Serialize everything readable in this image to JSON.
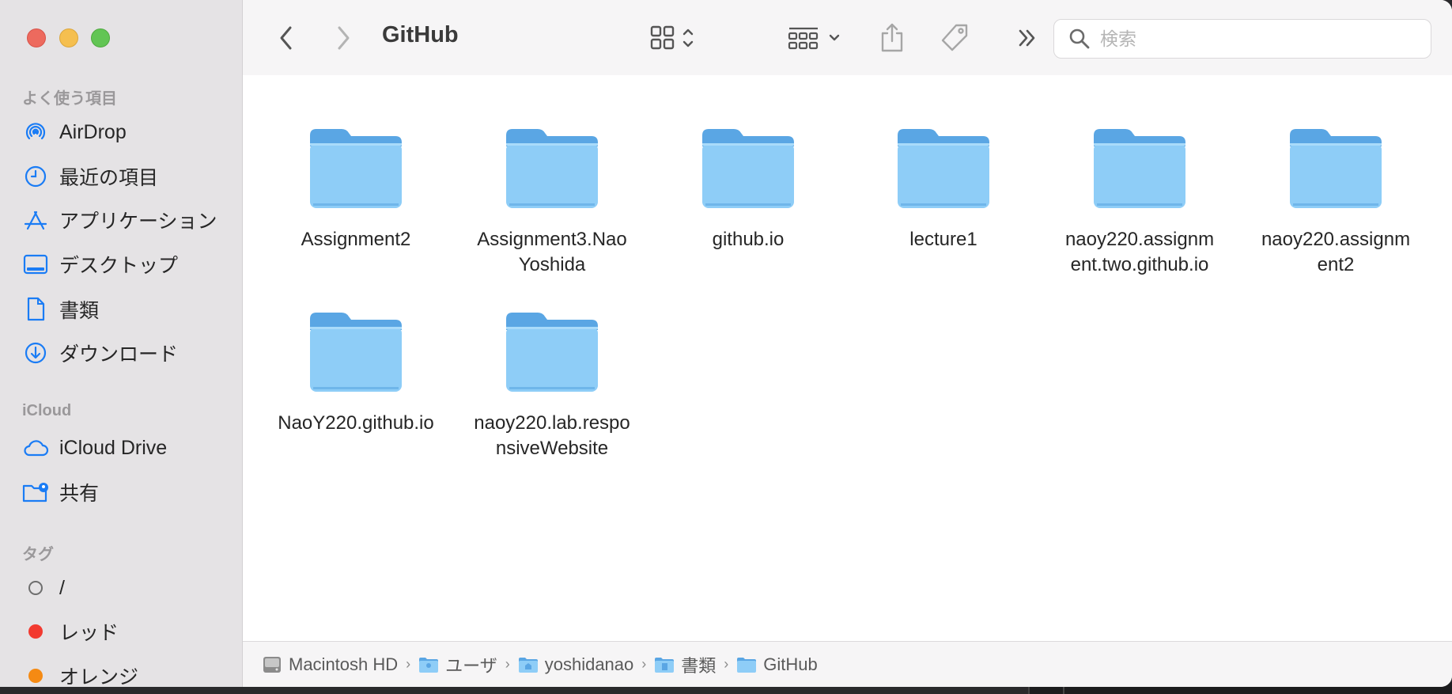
{
  "window": {
    "title": "GitHub"
  },
  "sidebar": {
    "favorites_title": "よく使う項目",
    "favorites": [
      {
        "label": "AirDrop",
        "icon": "airdrop-icon"
      },
      {
        "label": "最近の項目",
        "icon": "clock-icon"
      },
      {
        "label": "アプリケーション",
        "icon": "applications-icon"
      },
      {
        "label": "デスクトップ",
        "icon": "desktop-icon"
      },
      {
        "label": "書類",
        "icon": "document-icon"
      },
      {
        "label": "ダウンロード",
        "icon": "download-icon"
      }
    ],
    "icloud_title": "iCloud",
    "icloud": [
      {
        "label": "iCloud Drive",
        "icon": "cloud-icon"
      },
      {
        "label": "共有",
        "icon": "shared-folder-icon"
      }
    ],
    "tags_title": "タグ",
    "tags": [
      {
        "label": "/",
        "color": "#ffffff"
      },
      {
        "label": "レッド",
        "color": "#f23a30"
      },
      {
        "label": "オレンジ",
        "color": "#f58a13"
      }
    ]
  },
  "search": {
    "placeholder": "検索"
  },
  "folders": [
    {
      "name": "Assignment2"
    },
    {
      "name": "Assignment3.NaoYoshida"
    },
    {
      "name": "github.io"
    },
    {
      "name": "lecture1"
    },
    {
      "name": "naoy220.assignment.two.github.io"
    },
    {
      "name": "naoy220.assignment2"
    },
    {
      "name": "NaoY220.github.io"
    },
    {
      "name": "naoy220.lab.responsiveWebsite"
    }
  ],
  "path": [
    {
      "label": "Macintosh HD",
      "icon": "hard-drive-icon"
    },
    {
      "label": "ユーザ",
      "icon": "users-folder-icon"
    },
    {
      "label": "yoshidanao",
      "icon": "home-folder-icon"
    },
    {
      "label": "書類",
      "icon": "documents-folder-icon"
    },
    {
      "label": "GitHub",
      "icon": "folder-icon"
    }
  ],
  "colors": {
    "accent": "#1a7cf5",
    "folder": "#8ecdf7",
    "folder_dark": "#5aa6e4"
  }
}
